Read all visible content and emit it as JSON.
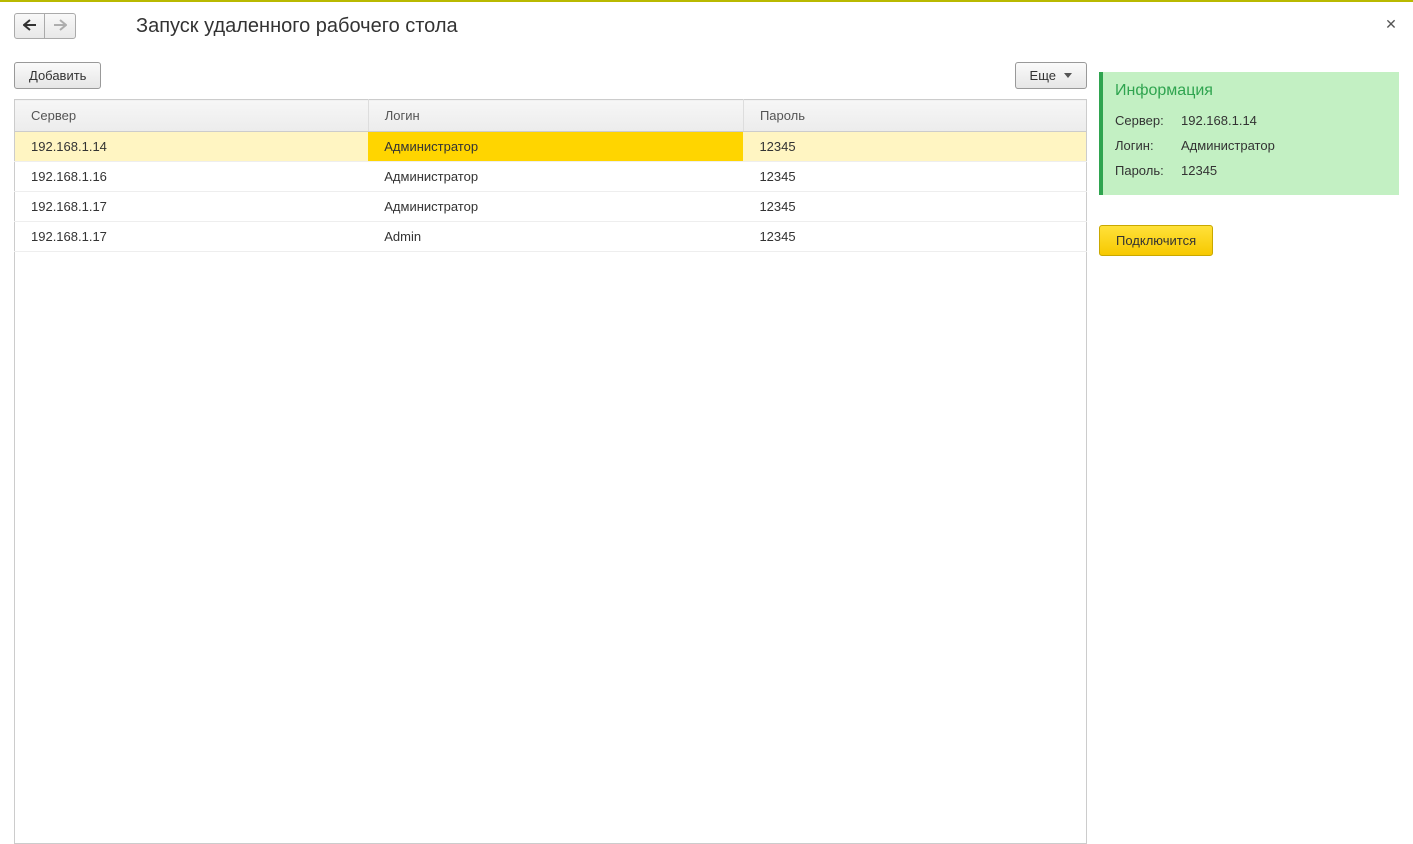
{
  "header": {
    "title": "Запуск удаленного рабочего стола"
  },
  "toolbar": {
    "add_label": "Добавить",
    "more_label": "Еще"
  },
  "table": {
    "headers": {
      "server": "Сервер",
      "login": "Логин",
      "password": "Пароль"
    },
    "rows": [
      {
        "server": "192.168.1.14",
        "login": "Администратор",
        "password": "12345",
        "selected": true
      },
      {
        "server": "192.168.1.16",
        "login": "Администратор",
        "password": "12345",
        "selected": false
      },
      {
        "server": "192.168.1.17",
        "login": "Администратор",
        "password": "12345",
        "selected": false
      },
      {
        "server": "192.168.1.17",
        "login": "Admin",
        "password": "12345",
        "selected": false
      }
    ]
  },
  "info": {
    "title": "Информация",
    "server_label": "Сервер:",
    "login_label": "Логин:",
    "password_label": "Пароль:",
    "server_value": "192.168.1.14",
    "login_value": "Администратор",
    "password_value": "12345"
  },
  "actions": {
    "connect_label": "Подключится"
  }
}
